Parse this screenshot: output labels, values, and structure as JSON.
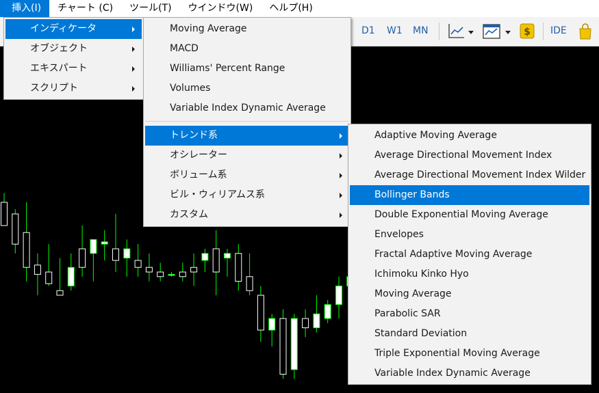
{
  "menubar": {
    "items": [
      "挿入(I)",
      "チャート (C)",
      "ツール(T)",
      "ウインドウ(W)",
      "ヘルプ(H)"
    ]
  },
  "toolbar": {
    "timeframes": [
      "D1",
      "W1",
      "MN"
    ],
    "ide_label": "IDE",
    "icons": [
      "line-chart-icon",
      "chart-template-icon",
      "dollar-icon",
      "market-bag-icon"
    ]
  },
  "insert_menu": {
    "items": [
      "インディケータ",
      "オブジェクト",
      "エキスパート",
      "スクリプト"
    ]
  },
  "indicator_menu": {
    "top_items": [
      "Moving Average",
      "MACD",
      "Williams' Percent Range",
      "Volumes",
      "Variable Index Dynamic Average"
    ],
    "categories": [
      "トレンド系",
      "オシレーター",
      "ボリューム系",
      "ビル・ウィリアムス系",
      "カスタム"
    ]
  },
  "trend_menu": {
    "items": [
      "Adaptive Moving Average",
      "Average Directional Movement Index",
      "Average Directional Movement Index Wilder",
      "Bollinger Bands",
      "Double Exponential Moving Average",
      "Envelopes",
      "Fractal Adaptive Moving Average",
      "Ichimoku Kinko Hyo",
      "Moving Average",
      "Parabolic SAR",
      "Standard Deviation",
      "Triple Exponential Moving Average",
      "Variable Index Dynamic Average"
    ]
  },
  "colors": {
    "highlight": "#0078d7",
    "candle_up": "#ffffff",
    "wick": "#00ff00",
    "chart_bg": "#000000",
    "menu_bg": "#f2f2f2",
    "timeframe_text": "#1f5fa8"
  },
  "chart_data": {
    "type": "candlestick",
    "candles": [
      {
        "o": 0.8,
        "h": 0.84,
        "l": 0.72,
        "c": 0.7
      },
      {
        "o": 0.75,
        "h": 0.77,
        "l": 0.58,
        "c": 0.62
      },
      {
        "o": 0.67,
        "h": 0.8,
        "l": 0.46,
        "c": 0.52
      },
      {
        "o": 0.53,
        "h": 0.58,
        "l": 0.4,
        "c": 0.49
      },
      {
        "o": 0.5,
        "h": 0.62,
        "l": 0.44,
        "c": 0.45
      },
      {
        "o": 0.42,
        "h": 0.56,
        "l": 0.4,
        "c": 0.4
      },
      {
        "o": 0.44,
        "h": 0.58,
        "l": 0.42,
        "c": 0.52
      },
      {
        "o": 0.6,
        "h": 0.7,
        "l": 0.48,
        "c": 0.52
      },
      {
        "o": 0.58,
        "h": 0.64,
        "l": 0.46,
        "c": 0.64
      },
      {
        "o": 0.62,
        "h": 0.68,
        "l": 0.55,
        "c": 0.63
      },
      {
        "o": 0.6,
        "h": 0.75,
        "l": 0.5,
        "c": 0.55
      },
      {
        "o": 0.56,
        "h": 0.64,
        "l": 0.48,
        "c": 0.6
      },
      {
        "o": 0.55,
        "h": 0.62,
        "l": 0.48,
        "c": 0.52
      },
      {
        "o": 0.52,
        "h": 0.58,
        "l": 0.46,
        "c": 0.5
      },
      {
        "o": 0.5,
        "h": 0.54,
        "l": 0.46,
        "c": 0.48
      },
      {
        "o": 0.49,
        "h": 0.5,
        "l": 0.48,
        "c": 0.49
      },
      {
        "o": 0.5,
        "h": 0.54,
        "l": 0.46,
        "c": 0.48
      },
      {
        "o": 0.52,
        "h": 0.58,
        "l": 0.44,
        "c": 0.5
      },
      {
        "o": 0.55,
        "h": 0.6,
        "l": 0.5,
        "c": 0.58
      },
      {
        "o": 0.6,
        "h": 0.68,
        "l": 0.4,
        "c": 0.5
      },
      {
        "o": 0.56,
        "h": 0.6,
        "l": 0.48,
        "c": 0.58
      },
      {
        "o": 0.58,
        "h": 0.62,
        "l": 0.42,
        "c": 0.46
      },
      {
        "o": 0.48,
        "h": 0.58,
        "l": 0.4,
        "c": 0.42
      },
      {
        "o": 0.4,
        "h": 0.44,
        "l": 0.2,
        "c": 0.25
      },
      {
        "o": 0.25,
        "h": 0.32,
        "l": 0.18,
        "c": 0.3
      },
      {
        "o": 0.3,
        "h": 0.34,
        "l": 0.04,
        "c": 0.06
      },
      {
        "o": 0.08,
        "h": 0.32,
        "l": 0.04,
        "c": 0.3
      },
      {
        "o": 0.3,
        "h": 0.34,
        "l": 0.22,
        "c": 0.26
      },
      {
        "o": 0.26,
        "h": 0.4,
        "l": 0.24,
        "c": 0.32
      },
      {
        "o": 0.3,
        "h": 0.38,
        "l": 0.28,
        "c": 0.36
      },
      {
        "o": 0.36,
        "h": 0.48,
        "l": 0.3,
        "c": 0.44
      },
      {
        "o": 0.44,
        "h": 0.5,
        "l": 0.36,
        "c": 0.48
      }
    ]
  }
}
